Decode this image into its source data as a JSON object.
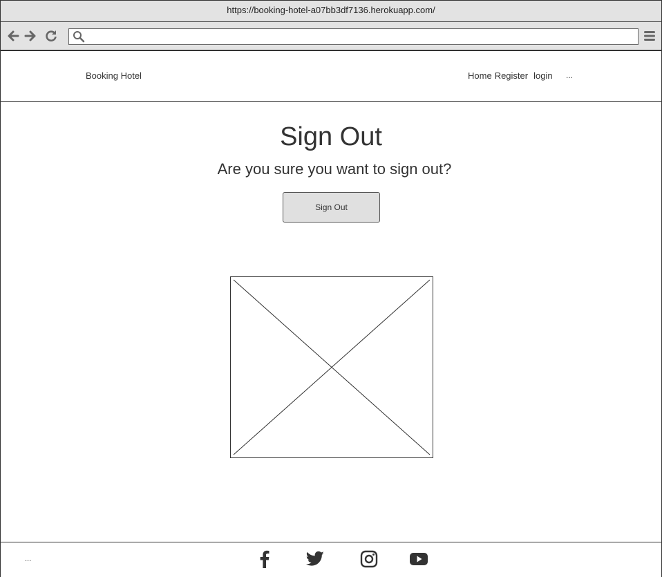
{
  "browser": {
    "url": "https://booking-hotel-a07bb3df7136.herokuapp.com/",
    "search_value": "",
    "icons": [
      "back-arrow-icon",
      "forward-arrow-icon",
      "reload-icon",
      "search-icon",
      "hamburger-menu-icon"
    ]
  },
  "navbar": {
    "brand": "Booking Hotel",
    "links": [
      "Home",
      "Register",
      "login"
    ],
    "more": "..."
  },
  "main": {
    "title": "Sign Out",
    "subtitle": "Are you sure you want to sign out?",
    "button_label": "Sign Out",
    "image_placeholder": "image-placeholder"
  },
  "footer": {
    "dots": "...",
    "social": [
      "facebook-icon",
      "twitter-icon",
      "instagram-icon",
      "youtube-icon"
    ]
  },
  "colors": {
    "chrome": "#e3e3e3",
    "border": "#333333",
    "button": "#e0e0e0",
    "text": "#333333"
  }
}
